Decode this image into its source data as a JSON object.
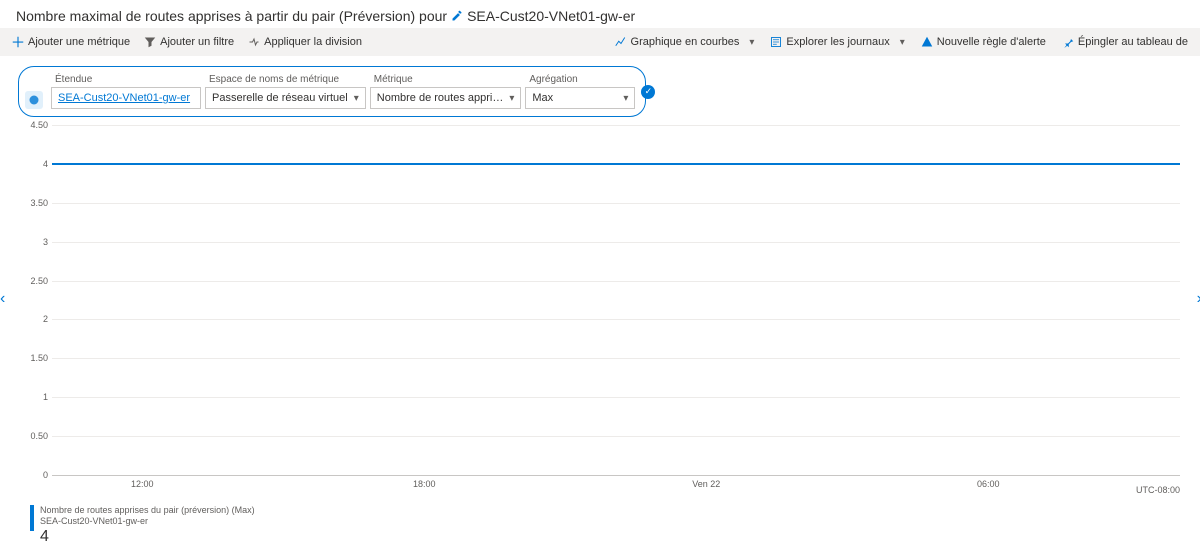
{
  "title_prefix": "Nombre maximal de routes apprises à partir du pair (Préversion) pour",
  "title_resource": "SEA-Cust20-VNet01-gw-er",
  "toolbar": {
    "add_metric": "Ajouter une métrique",
    "add_filter": "Ajouter un filtre",
    "apply_split": "Appliquer la division",
    "line_chart": "Graphique en courbes",
    "drill_logs": "Explorer les journaux",
    "new_alert": "Nouvelle règle d'alerte",
    "pin_dashboard": "Épingler au tableau de"
  },
  "params": {
    "scope": {
      "label": "Étendue",
      "value": "SEA-Cust20-VNet01-gw-er"
    },
    "ns": {
      "label": "Espace de noms de métrique",
      "value": "Passerelle de réseau virtuel"
    },
    "metric": {
      "label": "Métrique",
      "value": "Nombre de routes appri…"
    },
    "agg": {
      "label": "Agrégation",
      "value": "Max"
    }
  },
  "chart_data": {
    "type": "line",
    "title": "Nombre maximal de routes apprises à partir du pair (Préversion)",
    "x": [
      "12:00",
      "18:00",
      "Ven 22",
      "06:00"
    ],
    "series": [
      {
        "name": "Nombre de routes apprises du pair (préversion) (Max) — SEA-Cust20-VNet01-gw-er",
        "values": [
          4,
          4,
          4,
          4
        ],
        "color": "#0078d4"
      }
    ],
    "ylim": [
      0,
      4.5
    ],
    "yticks": [
      0,
      0.5,
      1,
      1.5,
      2,
      2.5,
      3,
      3.5,
      4,
      4.5
    ],
    "timezone": "UTC-08:00",
    "ylabel": "",
    "xlabel": ""
  },
  "legend": {
    "line1": "Nombre de routes apprises du pair (préversion) (Max)",
    "line2": "SEA-Cust20-VNet01-gw-er",
    "value": "4"
  },
  "yticks_render": [
    {
      "v": "4.50",
      "p": 0
    },
    {
      "v": "4",
      "p": 11.11
    },
    {
      "v": "3.50",
      "p": 22.22
    },
    {
      "v": "3",
      "p": 33.33
    },
    {
      "v": "2.50",
      "p": 44.44
    },
    {
      "v": "2",
      "p": 55.55
    },
    {
      "v": "1.50",
      "p": 66.66
    },
    {
      "v": "1",
      "p": 77.77
    },
    {
      "v": "0.50",
      "p": 88.88
    },
    {
      "v": "0",
      "p": 100
    }
  ],
  "xticks_render": [
    {
      "v": "12:00",
      "p": 8
    },
    {
      "v": "18:00",
      "p": 33
    },
    {
      "v": "Ven 22",
      "p": 58
    },
    {
      "v": "06:00",
      "p": 83
    }
  ],
  "data_y_percent": 11.11
}
